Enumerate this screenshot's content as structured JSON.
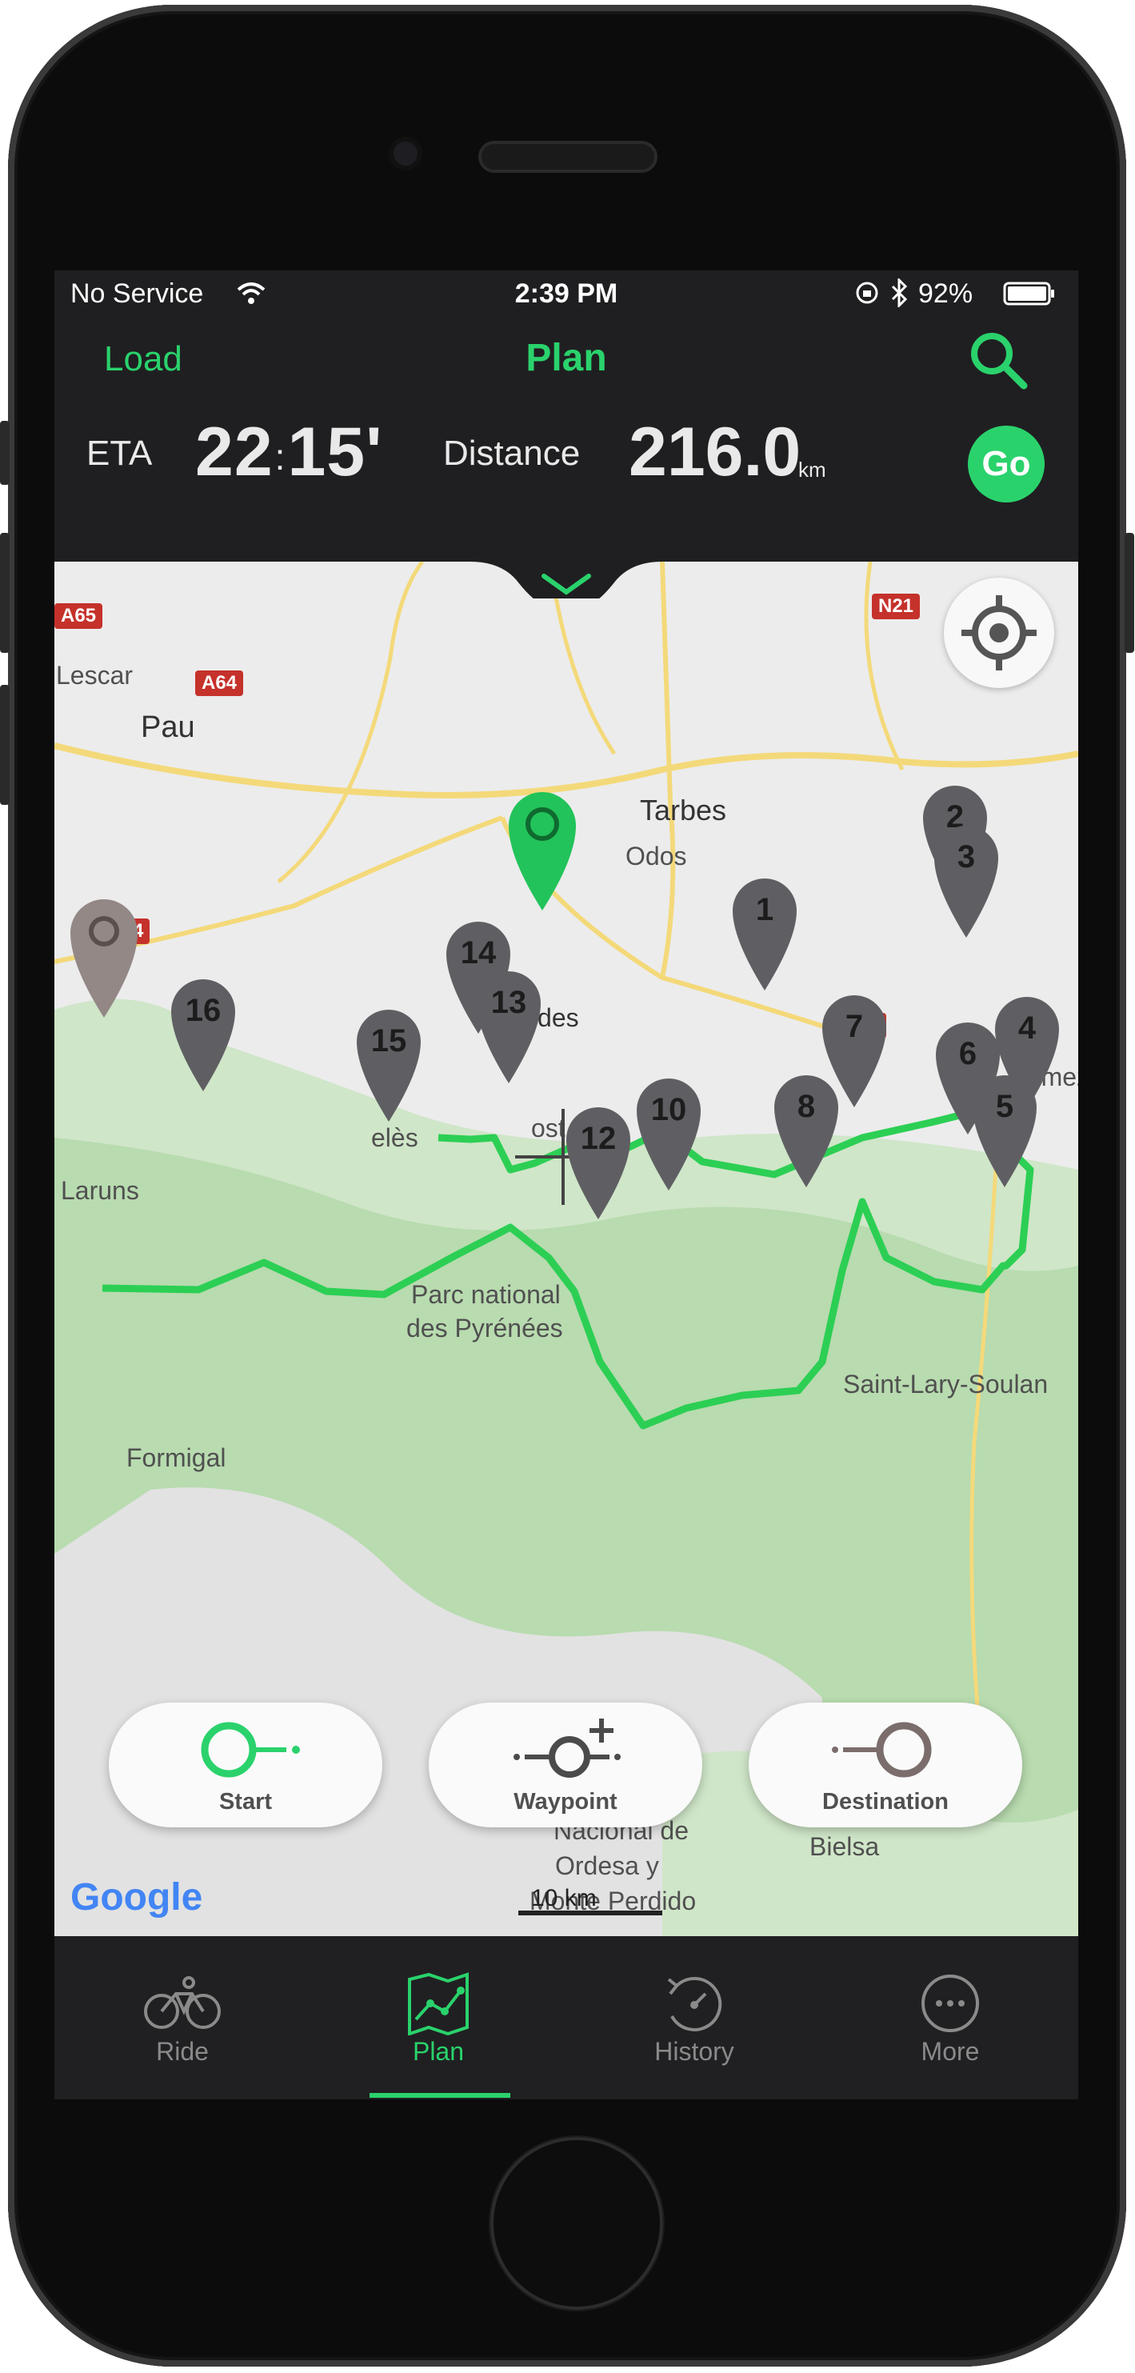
{
  "status_bar": {
    "carrier": "No Service",
    "time": "2:39 PM",
    "battery": "92%"
  },
  "nav": {
    "left": "Load",
    "title": "Plan"
  },
  "summary": {
    "eta_label": "ETA",
    "eta_hours": "22",
    "eta_sep": ":",
    "eta_minutes": "15'",
    "distance_label": "Distance",
    "distance_value": "216.0",
    "distance_unit": "km",
    "go_label": "Go"
  },
  "map": {
    "places": [
      "Lescar",
      "Pau",
      "Tarbes",
      "Odos",
      "Lourdes",
      "Laruns",
      "Parc national",
      "des Pyrénées",
      "Saint-Lary-Soulan",
      "Formigal",
      "Nacional de",
      "Ordesa y",
      "Monte Perdido",
      "Bielsa",
      "nemez",
      "elès",
      "ost"
    ],
    "roads": [
      "A65",
      "A64",
      "A64",
      "N134",
      "N21",
      "A64"
    ],
    "waypoints": [
      "1",
      "2",
      "3",
      "4",
      "5",
      "6",
      "7",
      "8",
      "10",
      "12",
      "13",
      "14",
      "15",
      "16"
    ],
    "scale": "10 km",
    "attribution": "Google"
  },
  "controls": {
    "start": "Start",
    "waypoint": "Waypoint",
    "destination": "Destination"
  },
  "tabs": [
    {
      "label": "Ride",
      "icon": "bicycle-icon"
    },
    {
      "label": "Plan",
      "icon": "route-map-icon"
    },
    {
      "label": "History",
      "icon": "history-icon"
    },
    {
      "label": "More",
      "icon": "more-icon"
    }
  ],
  "colors": {
    "accent": "#2ad26c",
    "pin": "#5f5f63",
    "route": "#2ccf54",
    "bar": "#1f1f21"
  }
}
